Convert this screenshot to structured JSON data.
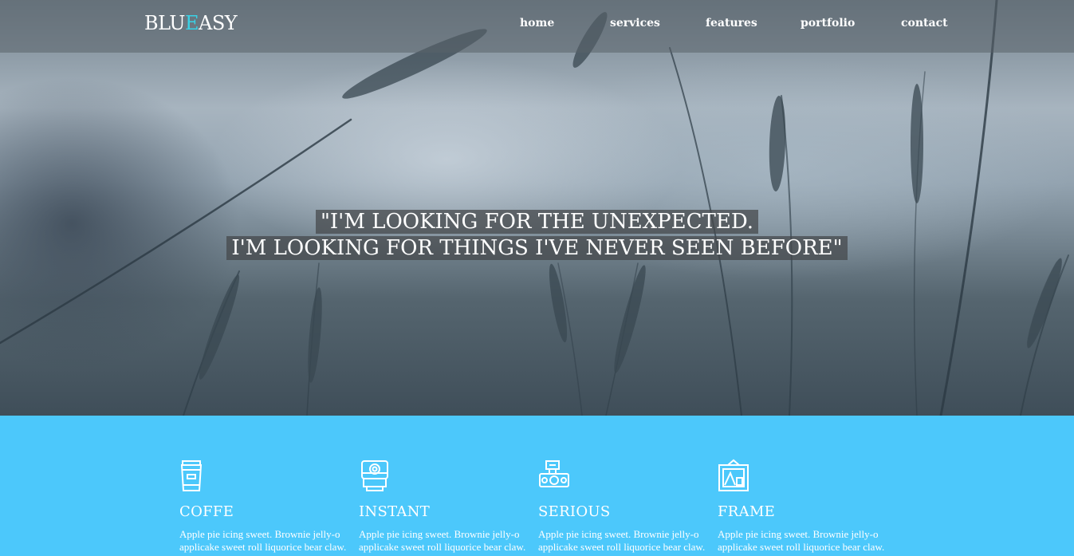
{
  "brand": {
    "prefix": "BLU",
    "accent": "E",
    "suffix": "ASY",
    "accent_color": "#39d2e6"
  },
  "nav": {
    "items": [
      {
        "label": "home"
      },
      {
        "label": "services"
      },
      {
        "label": "features"
      },
      {
        "label": "portfolio"
      },
      {
        "label": "contact"
      }
    ]
  },
  "hero": {
    "quote_line1": "\"I'M LOOKING FOR THE UNEXPECTED.",
    "quote_line2": "I'M LOOKING FOR THINGS I'VE NEVER SEEN BEFORE\""
  },
  "features": {
    "background_color": "#4cc8fb",
    "items": [
      {
        "icon": "coffee-cup-icon",
        "title": "COFFE",
        "desc1": "Apple pie icing sweet. Brownie jelly-o",
        "desc2": "applicake sweet roll liquorice bear claw."
      },
      {
        "icon": "instant-camera-icon",
        "title": "INSTANT",
        "desc1": "Apple pie icing sweet. Brownie jelly-o",
        "desc2": "applicake sweet roll liquorice bear claw."
      },
      {
        "icon": "serious-camera-icon",
        "title": "SERIOUS",
        "desc1": "Apple pie icing sweet. Brownie jelly-o",
        "desc2": "applicake sweet roll liquorice bear claw."
      },
      {
        "icon": "picture-frame-icon",
        "title": "FRAME",
        "desc1": "Apple pie icing sweet. Brownie jelly-o",
        "desc2": "applicake sweet roll liquorice bear claw."
      }
    ]
  }
}
